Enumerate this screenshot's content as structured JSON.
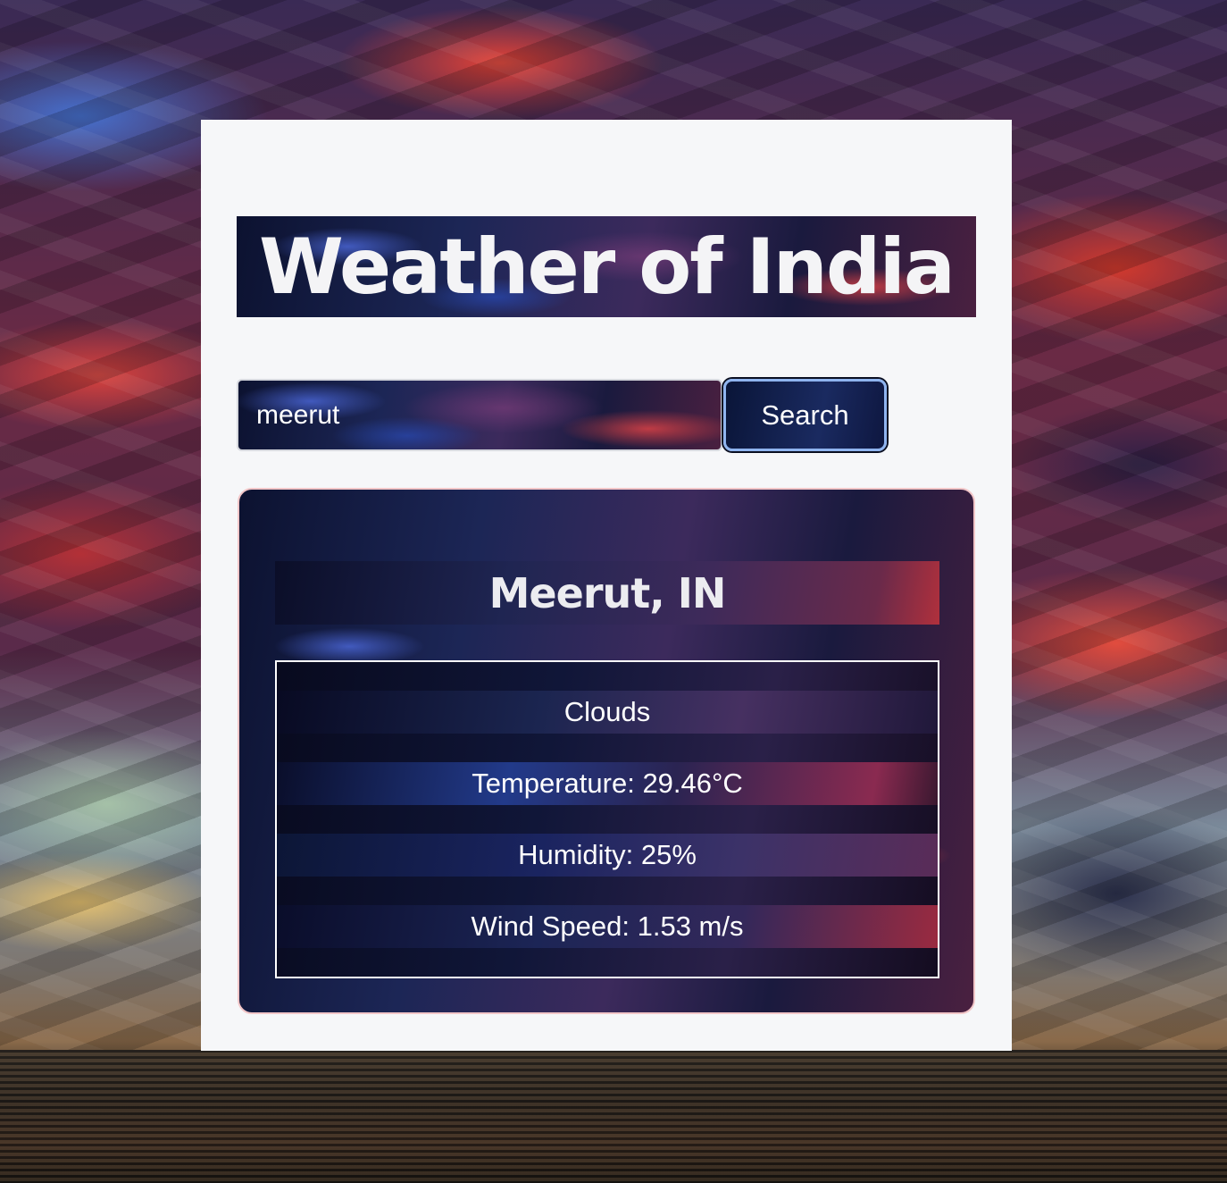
{
  "app": {
    "title": "Weather of India"
  },
  "search": {
    "value": "meerut",
    "button_label": "Search"
  },
  "result": {
    "city": "Meerut, IN",
    "condition": "Clouds",
    "temperature": "Temperature: 29.46°C",
    "humidity": "Humidity: 25%",
    "wind_speed": "Wind Speed: 1.53 m/s"
  },
  "colors": {
    "panel_background": "#f6f7f9",
    "button_border": "#8fb4ef",
    "card_border": "#f2c6c8",
    "text_light": "#ffffff"
  }
}
